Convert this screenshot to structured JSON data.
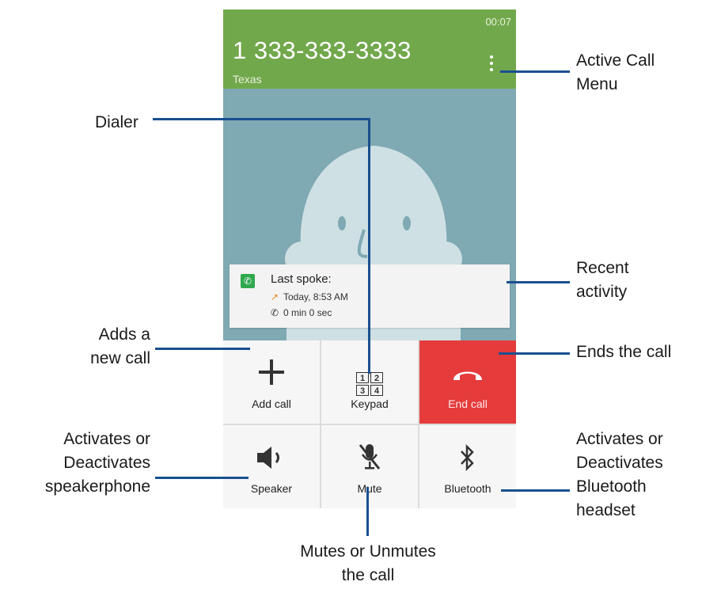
{
  "call": {
    "timer": "00:07",
    "number": "1 333-333-3333",
    "location": "Texas"
  },
  "recent": {
    "title": "Last spoke:",
    "line1": "Today, 8:53 AM",
    "line2": "0 min 0 sec"
  },
  "buttons": [
    {
      "label": "Add call",
      "icon": "plus-icon"
    },
    {
      "label": "Keypad",
      "icon": "keypad-icon"
    },
    {
      "label": "End call",
      "icon": "end-call-icon"
    },
    {
      "label": "Speaker",
      "icon": "speaker-icon"
    },
    {
      "label": "Mute",
      "icon": "mute-mic-icon"
    },
    {
      "label": "Bluetooth",
      "icon": "bluetooth-icon"
    }
  ],
  "keypad_digits": [
    "1",
    "2",
    "3",
    "4"
  ],
  "callouts": {
    "active_menu_1": "Active Call",
    "active_menu_2": "Menu",
    "dialer": "Dialer",
    "recent_1": "Recent",
    "recent_2": "activity",
    "add_1": "Adds a",
    "add_2": "new call",
    "ends": "Ends the call",
    "speaker_1": "Activates or",
    "speaker_2": "Deactivates",
    "speaker_3": "speakerphone",
    "bt_1": "Activates or",
    "bt_2": "Deactivates",
    "bt_3": "Bluetooth",
    "bt_4": "headset",
    "mute_1": "Mutes or Unmutes",
    "mute_2": "the call"
  },
  "colors": {
    "header_green": "#72a84c",
    "background_blue": "#7fa9b3",
    "end_call_red": "#e53b3b",
    "leader_line": "#1a4f8f"
  }
}
